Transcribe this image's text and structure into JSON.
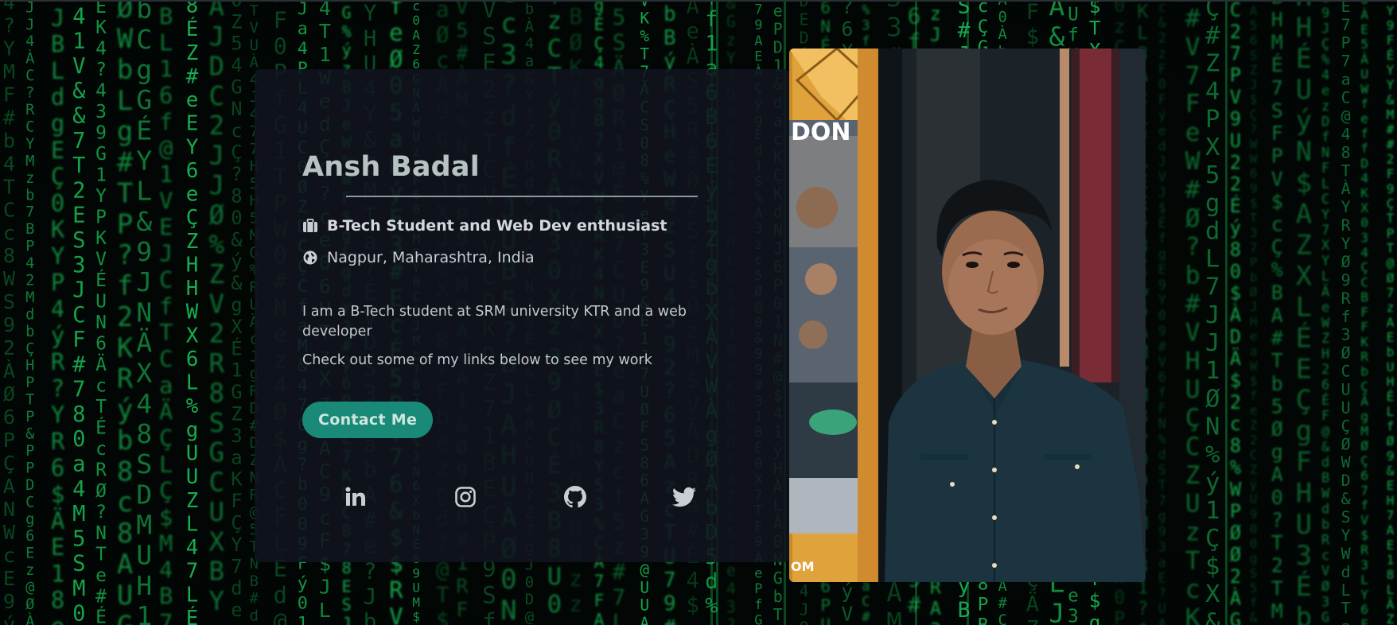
{
  "profile": {
    "name": "Ansh Badal",
    "role": "B-Tech Student and Web Dev enthusiast",
    "location": "Nagpur, Maharashtra, India",
    "bio_line_1": "I am a B-Tech student at SRM university KTR and a web developer",
    "bio_line_2": "Check out some of my links below to see my work",
    "contact_label": "Contact Me"
  },
  "social_links": [
    {
      "name": "linkedin",
      "icon": "linkedin-icon"
    },
    {
      "name": "instagram",
      "icon": "instagram-icon"
    },
    {
      "name": "github",
      "icon": "github-icon"
    },
    {
      "name": "twitter",
      "icon": "twitter-icon"
    }
  ],
  "icons": {
    "role": "briefcase-icon",
    "location": "globe-icon"
  },
  "colors": {
    "accent": "#1a8a78",
    "card_bg": "#111420",
    "matrix_green": "#19c45a",
    "name_text": "#b9c2c2"
  }
}
